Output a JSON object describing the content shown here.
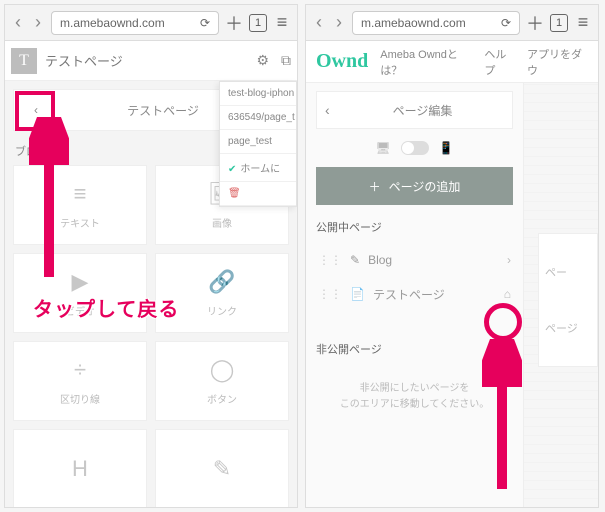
{
  "browser": {
    "url": "m.amebaownd.com",
    "tab_count": "1"
  },
  "left": {
    "title": "テストページ",
    "panel_title": "テストページ",
    "section_label": "ブロック",
    "tiles": [
      {
        "icon": "≡",
        "label": "テキスト"
      },
      {
        "icon": "🖼",
        "label": "画像"
      },
      {
        "icon": "▶",
        "label": "ビデオ"
      },
      {
        "icon": "🔗",
        "label": "リンク"
      },
      {
        "icon": "÷",
        "label": "区切り線"
      },
      {
        "icon": "◯",
        "label": "ボタン"
      },
      {
        "icon": "H",
        "label": ""
      },
      {
        "icon": "✎",
        "label": ""
      }
    ],
    "dropdown": {
      "line1": "test-blog-iphon",
      "line2": "636549/page_t",
      "line3": "page_test",
      "line4": "ホームに",
      "line5": ""
    },
    "annotation_text": "タップして戻る"
  },
  "right": {
    "logo": "Ownd",
    "nav": [
      "Ameba Owndとは？",
      "ヘルプ",
      "アプリをダウ"
    ],
    "panel_title": "ページ編集",
    "add_button": "ページの追加",
    "pub_heading": "公開中ページ",
    "pages": [
      {
        "icon": "✎",
        "label": "Blog",
        "right": "›"
      },
      {
        "icon": "📄",
        "label": "テストページ",
        "right": "⌂"
      }
    ],
    "nonpub_heading": "非公開ページ",
    "nonpub_msg1": "非公開にしたいページを",
    "nonpub_msg2": "このエリアに移動してください。",
    "canvas_l1": "ペー",
    "canvas_l2": "ページ"
  }
}
